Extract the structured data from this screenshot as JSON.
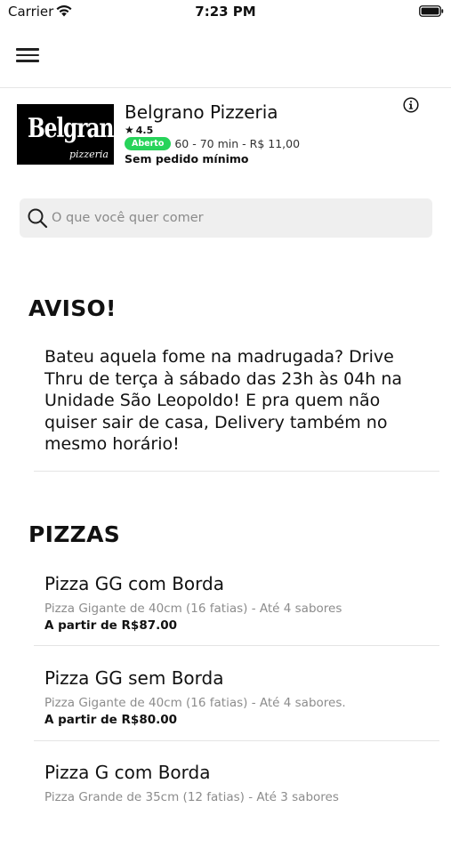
{
  "status_bar": {
    "carrier": "Carrier",
    "time": "7:23 PM"
  },
  "store": {
    "logo_text": "Belgrano",
    "logo_subtext": "pizzeria",
    "name": "Belgrano Pizzeria",
    "rating": "4.5",
    "status_badge": "Aberto",
    "delivery_info": "60 - 70 min - R$ 11,00",
    "min_order": "Sem pedido mínimo"
  },
  "search": {
    "placeholder": "O que você quer comer"
  },
  "notice": {
    "title": "AVISO!",
    "body": "Bateu aquela fome na madrugada? Drive Thru de terça à sábado das 23h às 04h na Unidade São Leopoldo! E pra quem não quiser sair de casa, Delivery também no mesmo horário!"
  },
  "menu": {
    "section_title": "PIZZAS",
    "items": [
      {
        "name": "Pizza GG com Borda",
        "description": "Pizza Gigante de 40cm (16 fatias) - Até 4 sabores",
        "price": "A partir de R$87.00"
      },
      {
        "name": "Pizza GG sem Borda",
        "description": "Pizza Gigante de 40cm (16 fatias) - Até 4 sabores.",
        "price": "A partir de R$80.00"
      },
      {
        "name": "Pizza G com Borda",
        "description": "Pizza Grande de 35cm (12 fatias) - Até 3 sabores",
        "price": ""
      }
    ]
  },
  "colors": {
    "badge_green": "#27d35a",
    "search_bg": "#efefef"
  },
  "icons": {
    "menu": "hamburger-menu-icon",
    "info": "info-icon",
    "search": "search-icon",
    "star": "star-icon"
  }
}
